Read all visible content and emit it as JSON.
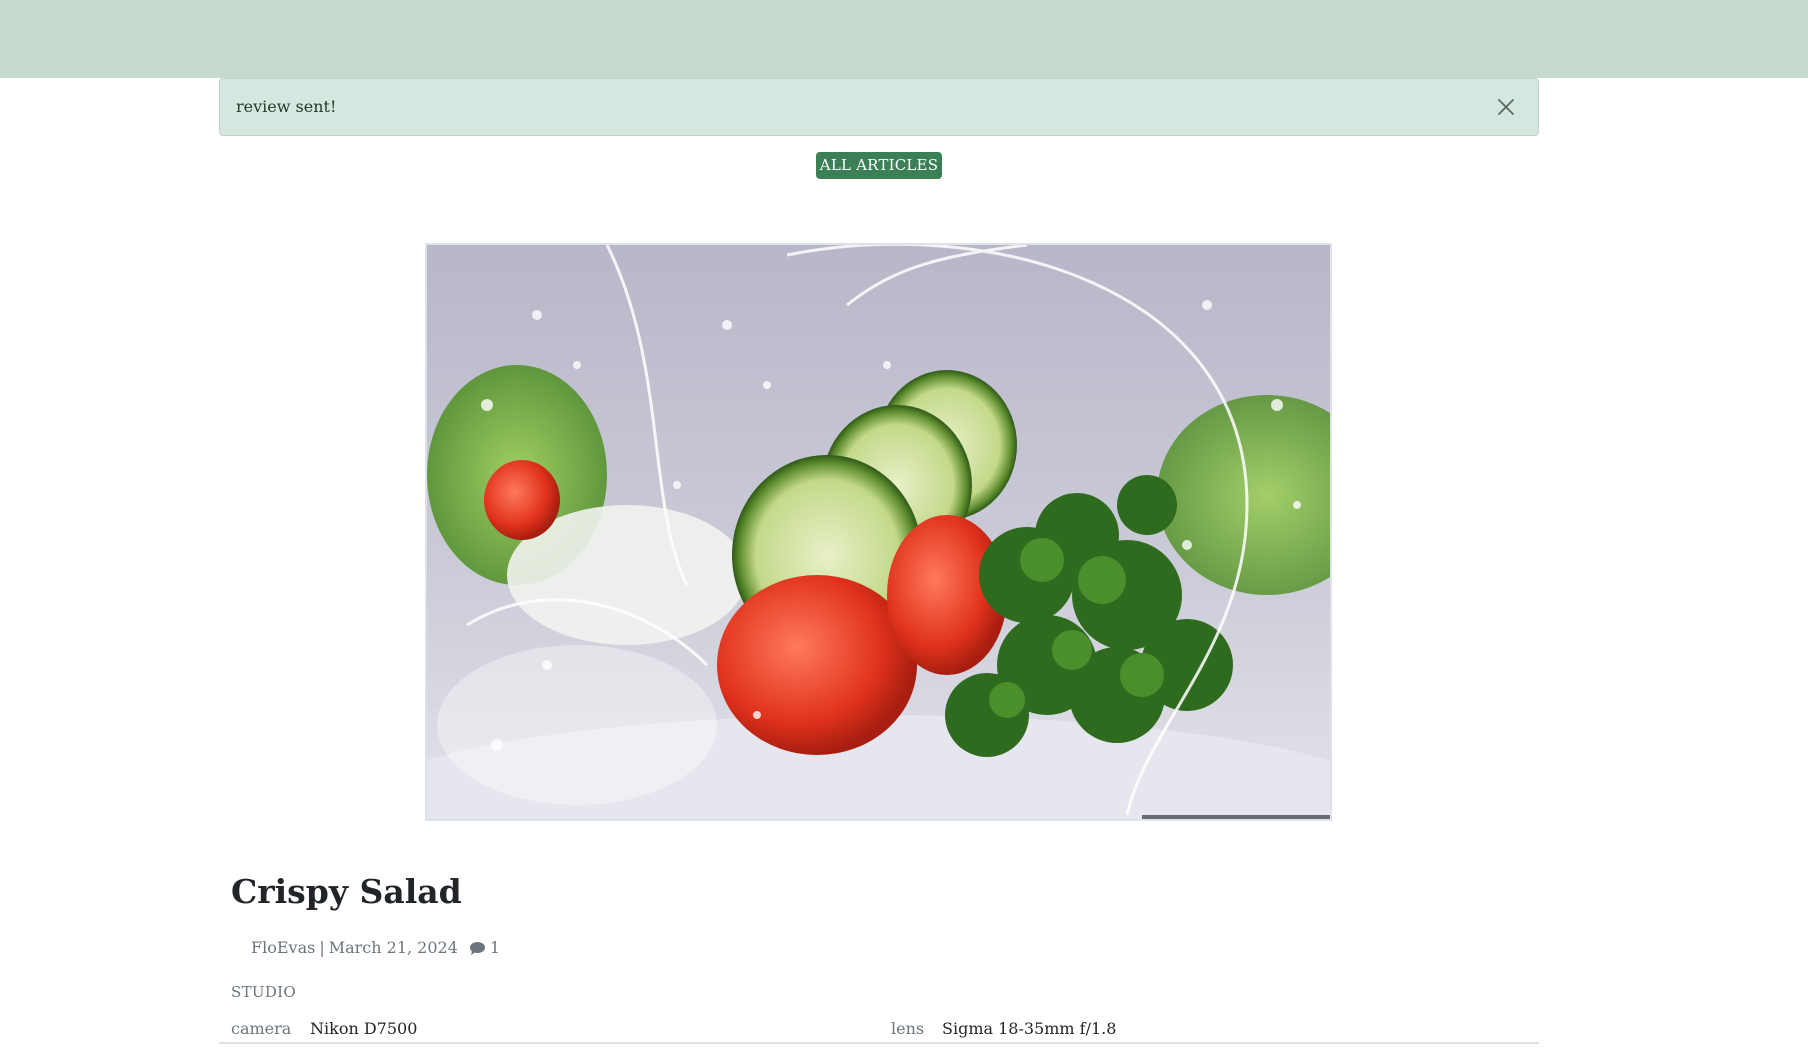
{
  "alert": {
    "message": "review sent!",
    "close_icon": "close-icon"
  },
  "nav": {
    "all_articles_label": "ALL ARTICLES"
  },
  "article": {
    "title": "Crispy Salad",
    "author": "FloEvas",
    "separator": "|",
    "date": "March 21, 2024",
    "comment_icon": "comment-icon",
    "comment_count": "1",
    "category": "STUDIO",
    "specs": [
      {
        "label": "camera",
        "value": "Nikon D7500"
      },
      {
        "label": "lens",
        "value": "Sigma 18-35mm f/1.8"
      }
    ]
  },
  "colors": {
    "topbar": "#c6dacf",
    "alert_bg": "#d6e7df",
    "button_bg": "#3b7f56"
  }
}
